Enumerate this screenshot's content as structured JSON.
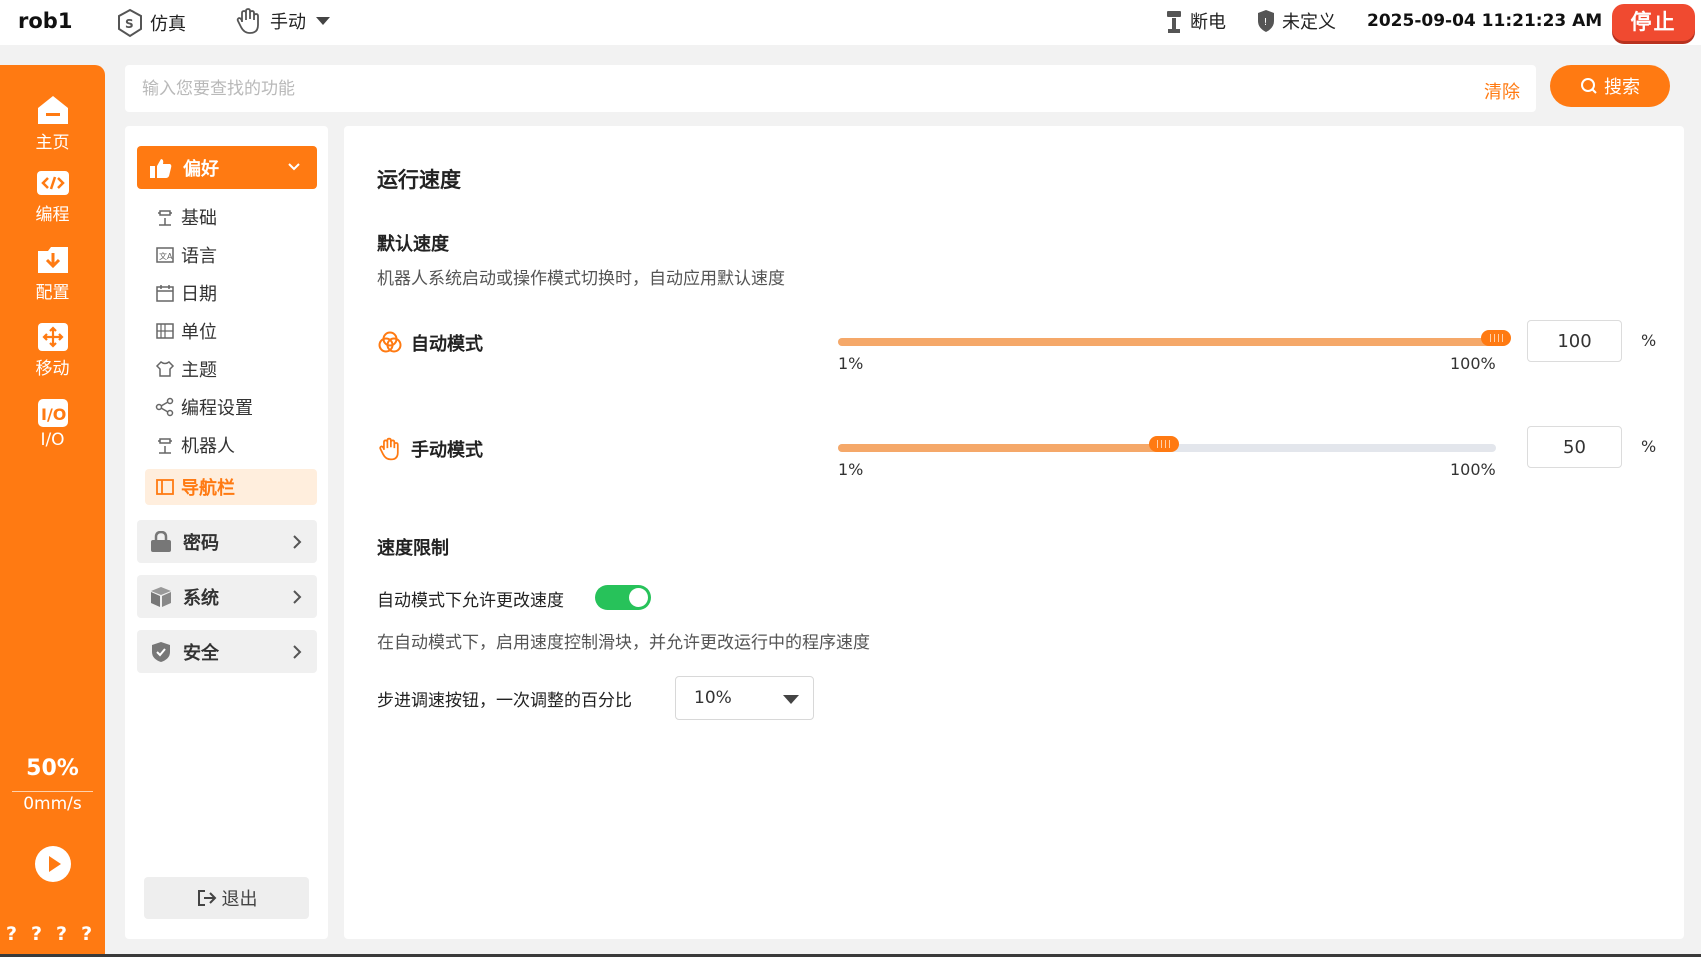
{
  "topbar": {
    "robot_name": "rob1",
    "sim_label": "仿真",
    "mode_label": "手动",
    "power_label": "断电",
    "safety_label": "未定义",
    "datetime": "2025-09-04 11:21:23 AM",
    "stop_label": "停止"
  },
  "rail": {
    "items": [
      {
        "label": "主页",
        "icon": "home-icon"
      },
      {
        "label": "编程",
        "icon": "code-icon"
      },
      {
        "label": "配置",
        "icon": "config-icon"
      },
      {
        "label": "移动",
        "icon": "move-icon"
      },
      {
        "label": "I/O",
        "icon": "io-icon"
      }
    ],
    "speed_percent": "50%",
    "speed_mm": "0mm/s",
    "status_marks": "????"
  },
  "search": {
    "placeholder": "输入您要查找的功能",
    "clear_label": "清除",
    "search_label": "搜索"
  },
  "nav": {
    "header": "偏好",
    "items": [
      {
        "label": "基础",
        "icon": "robot-arm-icon"
      },
      {
        "label": "语言",
        "icon": "language-icon"
      },
      {
        "label": "日期",
        "icon": "calendar-icon"
      },
      {
        "label": "单位",
        "icon": "grid-icon"
      },
      {
        "label": "主题",
        "icon": "shirt-icon"
      },
      {
        "label": "编程设置",
        "icon": "share-nodes-icon"
      },
      {
        "label": "机器人",
        "icon": "robot-arm-icon"
      },
      {
        "label": "导航栏",
        "icon": "sidebar-icon",
        "active": true
      }
    ],
    "groups": [
      {
        "label": "密码",
        "icon": "lock-icon"
      },
      {
        "label": "系统",
        "icon": "cube-icon"
      },
      {
        "label": "安全",
        "icon": "shield-check-icon"
      }
    ],
    "logout_label": "退出"
  },
  "content": {
    "title": "运行速度",
    "default_speed": {
      "heading": "默认速度",
      "description": "机器人系统启动或操作模式切换时，自动应用默认速度",
      "auto": {
        "label": "自动模式",
        "value": "100",
        "min_label": "1%",
        "max_label": "100%",
        "unit": "%",
        "level": 100
      },
      "manual": {
        "label": "手动模式",
        "value": "50",
        "min_label": "1%",
        "max_label": "100%",
        "unit": "%",
        "level": 50
      }
    },
    "speed_limit": {
      "heading": "速度限制",
      "toggle_label": "自动模式下允许更改速度",
      "toggle_on": true,
      "toggle_description": "在自动模式下，启用速度控制滑块，并允许更改运行中的程序速度",
      "step_label": "步进调速按钮，一次调整的百分比",
      "step_value": "10%"
    }
  },
  "colors": {
    "accent": "#ff7a12",
    "stop": "#f04a30",
    "toggle_on": "#27c25a",
    "slider_fill": "#f5a869"
  }
}
